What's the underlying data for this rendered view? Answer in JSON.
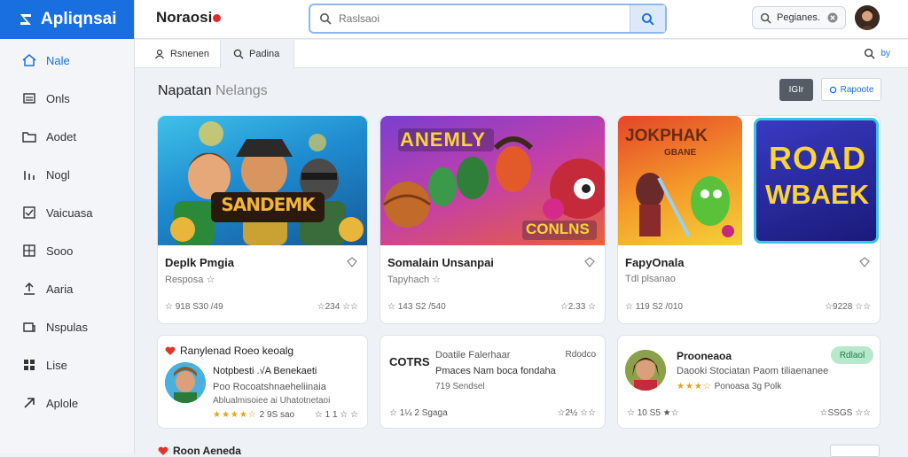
{
  "app": {
    "name": "Apliqnsai"
  },
  "sidebar": {
    "items": [
      {
        "label": "Nale",
        "icon": "home-icon",
        "active": true
      },
      {
        "label": "Onls",
        "icon": "list-icon"
      },
      {
        "label": "Aodet",
        "icon": "folder-icon"
      },
      {
        "label": "Nogl",
        "icon": "chart-icon"
      },
      {
        "label": "Vaicuasa",
        "icon": "checkbox-icon"
      },
      {
        "label": "Sooo",
        "icon": "grid-icon"
      },
      {
        "label": "Aaria",
        "icon": "upload-icon"
      },
      {
        "label": "Nspulas",
        "icon": "news-icon"
      },
      {
        "label": "Lise",
        "icon": "apps-icon"
      },
      {
        "label": "Aplole",
        "icon": "arrow-icon"
      }
    ]
  },
  "header": {
    "wordmark": "Noraosi",
    "search_placeholder": "Raslsaoi",
    "pages_label": "Pegianes.",
    "colors": {
      "accent": "#1a6fe0",
      "search_border": "#8fb6ee"
    }
  },
  "tabs": [
    {
      "label": "Rsnenen",
      "icon": "person-icon"
    },
    {
      "label": "Padina",
      "icon": "search-icon"
    }
  ],
  "tab_right_label": "by",
  "section": {
    "title": "Napatan",
    "subtitle": "Nelangs",
    "btn_dark": "IGIr",
    "btn_light": "Rapoote"
  },
  "cards": [
    {
      "title": "Deplk Pmgia",
      "sub": "Resposa ☆",
      "meta_left": "☆ 918 S30 /49",
      "meta_right": "☆234 ☆☆",
      "art_text": "SANDEMK"
    },
    {
      "title": "Somalain Unsanpai",
      "sub": "Tapyhach ☆",
      "meta_left": "☆ 143 S2 /540",
      "meta_right": "☆2.33 ☆",
      "art_text": "ANEMLY",
      "art_text2": "CONLNS"
    },
    {
      "title": "FapyOnala",
      "sub": "Tdl plsanao",
      "meta_left": "☆ 119 S2 /010",
      "meta_right": "☆9228 ☆☆",
      "art_text": "JOKPHAK",
      "art_sub": "GBANE"
    },
    {
      "title": "",
      "sub": "",
      "meta_left": "",
      "meta_right": "",
      "art_text": "ROAD",
      "art_text2": "WBAEK"
    }
  ],
  "lower": [
    {
      "header": "Ranylenad Roeo keoalg",
      "line1": "Notpbesti .√A Benekaeti",
      "line2": "Poo Rocoatshnaeheliinaia",
      "line3": "Ablualmisoiee ai Uhatotnetaoi",
      "stars": "★★★★☆",
      "rating": "2 9S sao",
      "meta_right": "☆ 1 1 ☆ ☆"
    },
    {
      "logo": "COTRS",
      "line1": "Doatile Falerhaar",
      "tag": "Rdodco",
      "line2": "Pmaces Nam boca fondaha",
      "line3": "719 Sendsel",
      "meta_left": "☆ 1¼ 2 Sgaga",
      "meta_right": "☆2½ ☆☆"
    },
    {
      "header": "Prooneaoa",
      "pill": "Rdlaol",
      "line1": "Daooki Stociatan Paom tiliaenanee",
      "stars": "★★★☆",
      "rating": "Ponoasa 3g Polk",
      "meta_left": "☆ 10 S5 ★☆",
      "meta_right": "☆SSGS ☆☆"
    }
  ],
  "footer_title": "Roon Aeneda"
}
